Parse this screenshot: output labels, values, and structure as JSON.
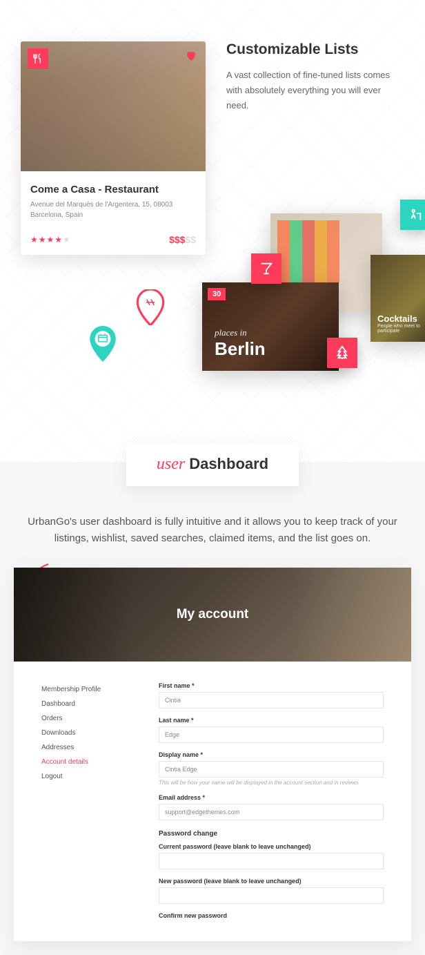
{
  "hero": {
    "title": "Customizable Lists",
    "desc": "A vast collection of fine-tuned lists comes with absolutely everything you will ever need."
  },
  "listing": {
    "title": "Come a Casa - Restaurant",
    "addr1": "Avenue del  Marquès de l'Argentera, 15, 08003",
    "addr2": "Barcelona, Spain",
    "price_on": "$$$",
    "price_off": "$$"
  },
  "berlin": {
    "count": "30",
    "script": "places in",
    "city": "Berlin"
  },
  "gallery": {
    "caption": "articipate"
  },
  "cocktails": {
    "title": "Cocktails",
    "sub": "People who meet to participate"
  },
  "dashboard": {
    "script": "user",
    "title": "Dashboard",
    "desc": "UrbanGo's user dashboard is fully intuitive and it allows you to keep track of your listings, wishlist, saved searches, claimed items, and the list goes on."
  },
  "account": {
    "title": "My account",
    "nav": [
      "Membership Profile",
      "Dashboard",
      "Orders",
      "Downloads",
      "Addresses",
      "Account details",
      "Logout"
    ],
    "active_nav": 5,
    "fields": {
      "first_name": {
        "label": "First name *",
        "value": "Cintia"
      },
      "last_name": {
        "label": "Last name *",
        "value": "Edge"
      },
      "display_name": {
        "label": "Display name *",
        "value": "Cintia Edge",
        "hint": "This will be how your name will be displayed in the account section and in reviews"
      },
      "email": {
        "label": "Email address *",
        "value": "support@edgethemes.com"
      },
      "pwd_section": "Password change",
      "current_pwd": {
        "label": "Current password (leave blank to leave unchanged)"
      },
      "new_pwd": {
        "label": "New password (leave blank to leave unchanged)"
      },
      "confirm_pwd": {
        "label": "Confirm new password"
      }
    }
  }
}
